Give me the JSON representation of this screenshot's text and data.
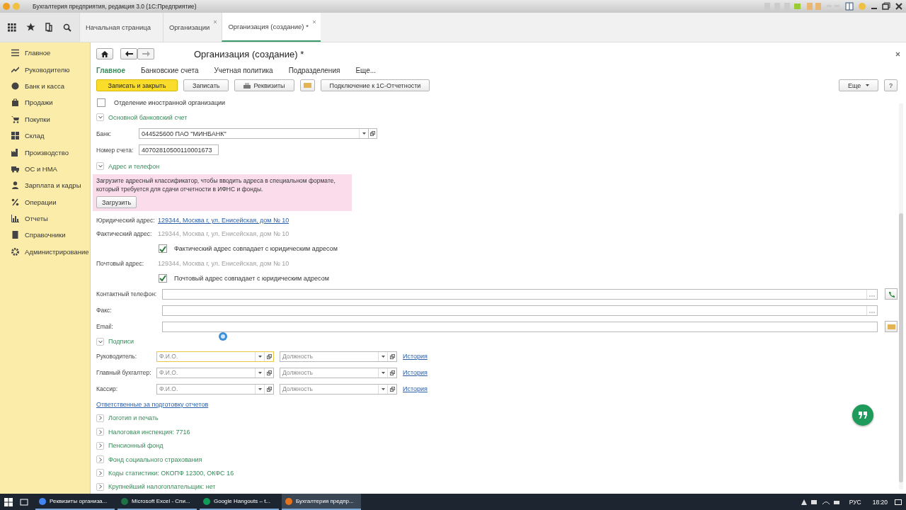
{
  "window": {
    "title": "Бухгалтерия предприятия, редакция 3.0  (1С:Предприятие)"
  },
  "tabs": [
    {
      "label": "Начальная страница",
      "selected": false,
      "closable": false
    },
    {
      "label": "Организации",
      "selected": false,
      "closable": true
    },
    {
      "label": "Организация (создание) *",
      "selected": true,
      "closable": true
    }
  ],
  "sidebar": {
    "items": [
      {
        "label": "Главное"
      },
      {
        "label": "Руководителю"
      },
      {
        "label": "Банк и касса"
      },
      {
        "label": "Продажи"
      },
      {
        "label": "Покупки"
      },
      {
        "label": "Склад"
      },
      {
        "label": "Производство"
      },
      {
        "label": "ОС и НМА"
      },
      {
        "label": "Зарплата и кадры"
      },
      {
        "label": "Операции"
      },
      {
        "label": "Отчеты"
      },
      {
        "label": "Справочники"
      },
      {
        "label": "Администрирование"
      }
    ]
  },
  "form": {
    "title": "Организация (создание) *",
    "nav": [
      {
        "label": "Главное",
        "selected": true
      },
      {
        "label": "Банковские счета",
        "selected": false
      },
      {
        "label": "Учетная политика",
        "selected": false
      },
      {
        "label": "Подразделения",
        "selected": false
      },
      {
        "label": "Еще...",
        "selected": false
      }
    ],
    "toolbar": [
      {
        "kind": "primary",
        "label": "Записать и закрыть"
      },
      {
        "kind": "button",
        "label": "Записать"
      },
      {
        "kind": "print",
        "label": "Реквизиты"
      },
      {
        "kind": "mail"
      },
      {
        "kind": "button",
        "label": "Подключение к 1С-Отчетности"
      }
    ],
    "more_button": "Еще",
    "help_button": "?",
    "foreign_branch": {
      "label": "Отделение иностранной организации",
      "checked": false
    },
    "bank_section": {
      "title": "Основной банковский счет",
      "expanded": true,
      "bank_label": "Банк:",
      "bank_value": "044525600 ПАО \"МИНБАНК\"",
      "account_label": "Номер счета:",
      "account_value": "40702810500110001673"
    },
    "address_section": {
      "title": "Адрес и телефон",
      "expanded": true,
      "notice": "Загрузите адресный классификатор, чтобы вводить адреса в специальном формате,\nкоторый требуется для сдачи отчетности в ИФНС и фонды.",
      "notice_button": "Загрузить",
      "legal_label": "Юридический адрес:",
      "legal_value": "129344, Москва г, ул. Енисейская, дом № 10",
      "actual_label": "Фактический адрес:",
      "actual_value": "129344, Москва г, ул. Енисейская, дом № 10",
      "actual_same": {
        "label": "Фактический адрес совпадает с юридическим адресом",
        "checked": true
      },
      "postal_label": "Почтовый адрес:",
      "postal_value": "129344, Москва г, ул. Енисейская, дом № 10",
      "postal_same": {
        "label": "Почтовый адрес совпадает с юридическим адресом",
        "checked": true
      },
      "contacts": [
        {
          "kind": "phone",
          "label": "Контактный телефон:"
        },
        {
          "kind": "fax",
          "label": "Факс:"
        },
        {
          "kind": "email",
          "label": "Email:"
        }
      ]
    },
    "signatures": {
      "title": "Подписи",
      "expanded": true,
      "rows": [
        {
          "label": "Руководитель:",
          "name_placeholder": "Ф.И.О.",
          "position_placeholder": "Должность",
          "history": "История",
          "focused": true
        },
        {
          "label": "Главный бухгалтер:",
          "name_placeholder": "Ф.И.О.",
          "position_placeholder": "Должность",
          "history": "История",
          "focused": false
        },
        {
          "label": "Кассир:",
          "name_placeholder": "Ф.И.О.",
          "position_placeholder": "Должность",
          "history": "История",
          "focused": false
        }
      ]
    },
    "responsible_link": "Ответственные за подготовку отчетов",
    "sections": [
      {
        "title": "Логотип и печать",
        "expanded": false
      },
      {
        "title": "Налоговая инспекция: 7716",
        "expanded": false
      },
      {
        "title": "Пенсионный фонд",
        "expanded": false
      },
      {
        "title": "Фонд социального страхования",
        "expanded": false
      },
      {
        "title": "Коды статистики: ОКОПФ 12300, ОКФС 16",
        "expanded": false
      },
      {
        "title": "Крупнейший налогоплательщик: нет",
        "expanded": false
      }
    ]
  },
  "taskbar": {
    "apps": [
      {
        "label": "Реквизиты организа...",
        "selected": false
      },
      {
        "label": "Microsoft Excel - Спи...",
        "selected": false
      },
      {
        "label": "Google Hangouts – t...",
        "selected": false
      },
      {
        "label": "Бухгалтерия предпр...",
        "selected": true
      }
    ],
    "language": "РУС",
    "time": "18:20"
  }
}
